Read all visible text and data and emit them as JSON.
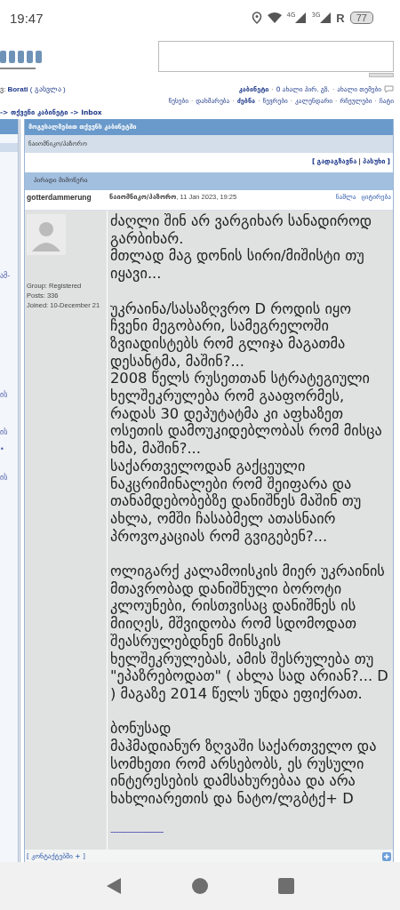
{
  "status_bar": {
    "time": "19:47",
    "network_labels": [
      "4G",
      "3G"
    ],
    "roaming": "R",
    "battery": "77"
  },
  "header": {
    "user_prefix": "ვ:",
    "username": "Borati",
    "logout": "( გასვლა )"
  },
  "user_links": [
    {
      "label": "კაბინეტი",
      "bold": true
    },
    {
      "label": "0 ახალი პირ. გზ.",
      "bold": false
    },
    {
      "label": "ახალი თემები",
      "bold": false
    }
  ],
  "nav_links": [
    {
      "label": "წესები",
      "bold": false
    },
    {
      "label": "დახმარება",
      "bold": false
    },
    {
      "label": "ძებნა",
      "bold": true
    },
    {
      "label": "წევრები",
      "bold": false
    },
    {
      "label": "კალენდარი",
      "bold": false
    },
    {
      "label": "რჩეულები",
      "bold": false
    },
    {
      "label": "ჩატი",
      "bold": false
    }
  ],
  "link_separator": "·",
  "action_separator": "|",
  "brackets": [
    "[",
    "]"
  ],
  "breadcrumb": "-> თქვენი კაბინეტი -> Inbox",
  "sidebar": {
    "items": [
      {
        "text": "ამ-"
      },
      {
        "text": "ის"
      },
      {
        "text": "ის"
      },
      {
        "text": "•"
      },
      {
        "text": "ის"
      }
    ]
  },
  "panel": {
    "title": "მოგესალმებით თქვენს კაბინეტში",
    "folder": "ნაიომნიკო/პაზორო",
    "actions": [
      "გადაგზავნა",
      "პასუხი"
    ],
    "section": "პირადი მიმოწერა"
  },
  "post": {
    "author": "gotterdammerung",
    "subject": "ნაიომნიკო/პაზორო",
    "date": ", 11 Jan 2023, 19:25",
    "buttons": [
      "ნაშლა",
      "ციტირება"
    ],
    "group": "Group: Registered",
    "posts": "Posts: 336",
    "joined": "Joined: 10-December 21",
    "paragraphs": [
      "ძაღლი შინ არ ვარგიხარ სანადიროდ გარბიხარ.\nმთლად მაგ დონის სირი/მიშისტი თუ იყავი...",
      "უკრაინა/სასაზღვრო D როდის იყო ჩვენი მეგობარი, სამეგრელოში ზვიადისტებს რომ გლიჯა მაგათმა დესანტმა, მაშინ?...\n2008 წელს რუსეთთან სტრატეგიული ხელშეკრულება რომ გააფორმეს, რადას 30 დეპუტატმა კი აფხაზეთ ოსეთის დამოუკიდებლობას რომ მისცა ხმა, მაშინ?...\nსაქართველოდან გაქცეული ნაკცრიმინალები რომ შეიფარა და თანამდებობებზე დანიშნეს მაშინ თუ ახლა, ომში ჩასაბმელ ათასნაირ პროვოკაციას რომ გვიგებენ?...",
      "ოლიგარქ კალამოისკის მიერ უკრაინის მთავრობად დანიშნული ბოროტი კლოუნები, რისთვისაც დანიშნეს ის მიიღეს, მშვიდობა რომ სდომოდათ შეასრულებდნენ მინსკის ხელშეკრულებას, ამის შესრულება თუ \"ეპაზრებოდათ\" ( ახლა სად არიან?... D ) მაგაზე 2014 წელს უნდა ეფიქრათ.",
      "ბონუსად\nმაჰმადიანურ ზღვაში საქართველო და სომხეთი რომ არსებობს, ეს რუსული ინტერესების დამსახურებაა და არა ხახლიარეთის და ნატო/ლგბტქ+ D"
    ],
    "signature": "--------------------",
    "contacts": "[ კონტაქტებში + ]"
  }
}
